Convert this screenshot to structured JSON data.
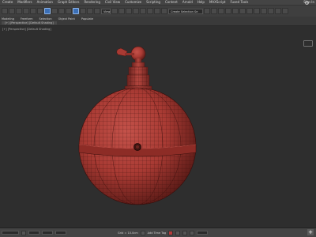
{
  "menubar": {
    "items": [
      "Create",
      "Modifiers",
      "Animation",
      "Graph Editors",
      "Rendering",
      "Civil View",
      "Customize",
      "Scripting",
      "Content",
      "Arnold",
      "Help",
      "MAXScript",
      "Fused Tools"
    ],
    "sign_in": "Sign In"
  },
  "toolbar": {
    "view_selector": "View",
    "named_selection": "Create Selection Se"
  },
  "ribbon": {
    "tabs": [
      "Modeling",
      "Freeform",
      "Selection",
      "Object Paint",
      "Populate"
    ],
    "sub": [
      "[+] [Perspective] [Default Shading]"
    ]
  },
  "viewport": {
    "label": "[+] [Perspective] [Default Shading]",
    "model_color": "#a83a33"
  },
  "statusbar": {
    "grid": "Grid = 10.0cm",
    "add_time_tag": "Add Time Tag"
  },
  "colors": {
    "accent": "#3b6fb6",
    "model": "#a83a33",
    "background": "#2e2e2e"
  }
}
